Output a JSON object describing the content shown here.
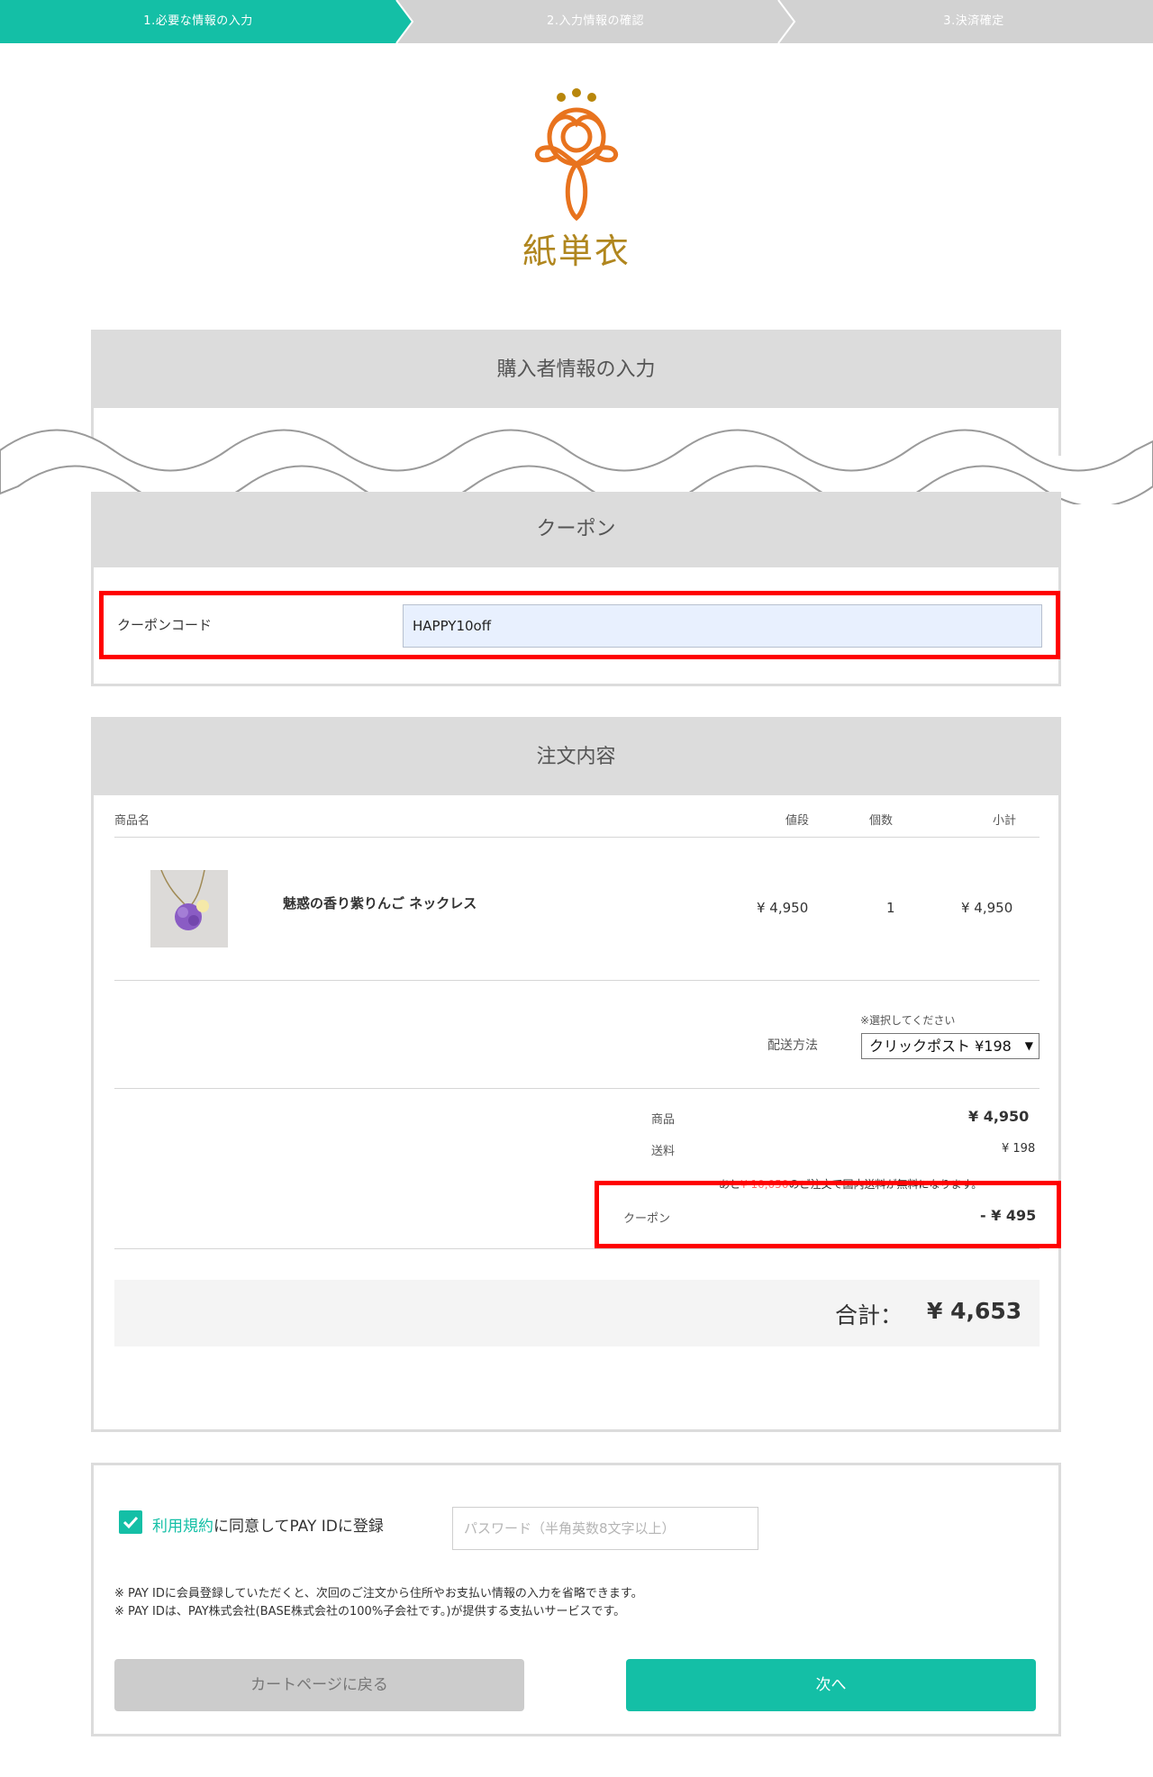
{
  "steps": [
    {
      "label": "1.必要な情報の入力",
      "active": true
    },
    {
      "label": "2.入力情報の確認",
      "active": false
    },
    {
      "label": "3.決済確定",
      "active": false
    }
  ],
  "logo": {
    "text": "紙単衣",
    "color_primary": "#e8731e",
    "color_secondary": "#b8860b"
  },
  "buyer_section": {
    "title": "購入者情報の入力"
  },
  "coupon_section": {
    "title": "クーポン",
    "code_label": "クーポンコード",
    "code_value": "HAPPY10off"
  },
  "order_section": {
    "title": "注文内容",
    "columns": {
      "name": "商品名",
      "price": "値段",
      "qty": "個数",
      "subtotal": "小計"
    },
    "items": [
      {
        "name": "魅惑の香り紫りんご ネックレス",
        "price": "¥ 4,950",
        "qty": "1",
        "subtotal": "¥ 4,950"
      }
    ],
    "shipping": {
      "note": "※選択してください",
      "label": "配送方法",
      "selected": "クリックポスト ¥198"
    },
    "summary": {
      "goods_label": "商品",
      "goods_value": "¥ 4,950",
      "shipping_label": "送料",
      "shipping_value": "¥ 198",
      "free_ship_prefix": "あと",
      "free_ship_amount": "¥ 10,050",
      "free_ship_suffix": "のご注文で国内送料が無料になります。",
      "coupon_label": "クーポン",
      "coupon_value": "- ¥ 495"
    },
    "total": {
      "label": "合計：",
      "value": "¥ 4,653"
    }
  },
  "payid": {
    "terms_link": "利用規約",
    "agree_text": "に同意してPAY IDに登録",
    "checked": true,
    "password_placeholder": "パスワード（半角英数8文字以上）",
    "note1": "※ PAY IDに会員登録していただくと、次回のご注文から住所やお支払い情報の入力を省略できます。",
    "note2": "※ PAY IDは、PAY株式会社(BASE株式会社の100%子会社です。)が提供する支払いサービスです。"
  },
  "buttons": {
    "back": "カートページに戻る",
    "next": "次へ"
  },
  "colors": {
    "accent": "#14bfa6",
    "step_inactive": "#d2d2d2",
    "highlight": "#ff0000",
    "link": "#14bfa6",
    "free_ship_amount": "#ff6b6b"
  }
}
